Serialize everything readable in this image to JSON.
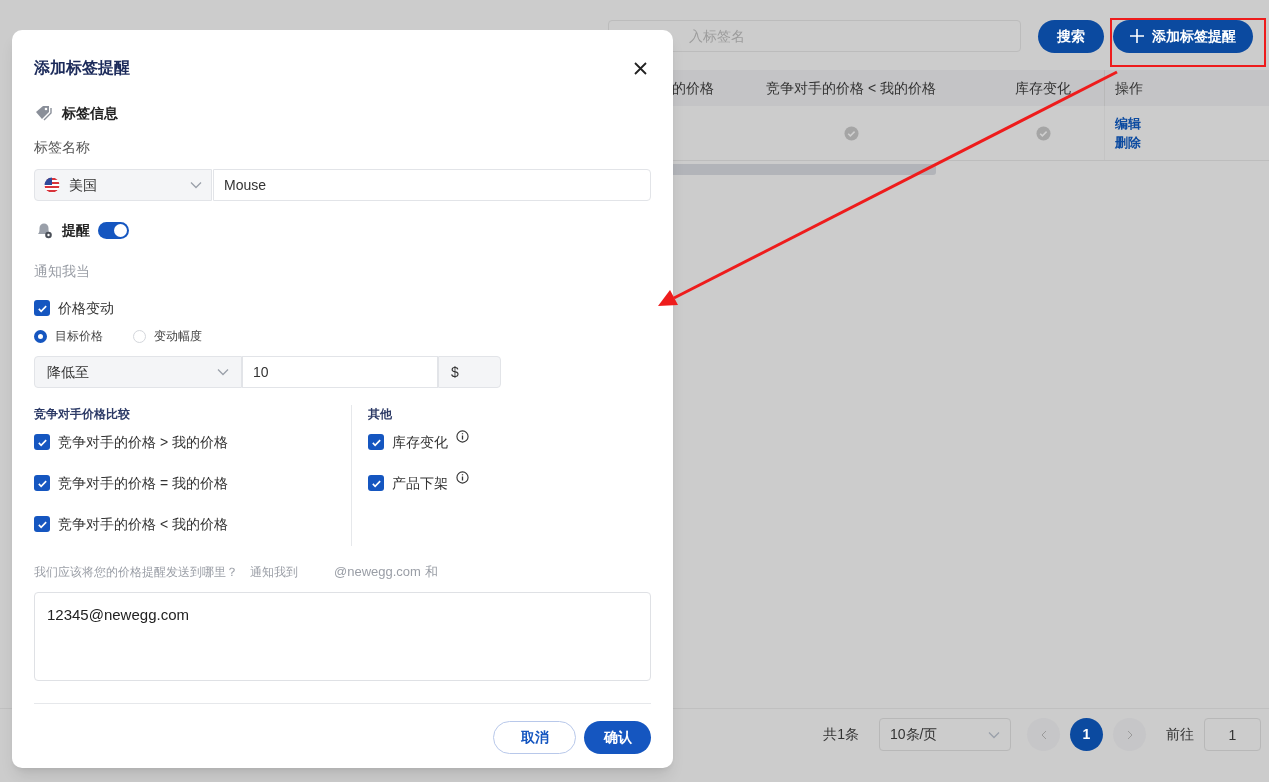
{
  "toolbar": {
    "search_placeholder": "入标签名",
    "buttons": [
      {
        "label": "搜索",
        "kind": "plain"
      },
      {
        "label": "添加标签提醒",
        "kind": "add"
      }
    ]
  },
  "table": {
    "columns": [
      "的价格",
      "竞争对手的价格 < 我的价格",
      "库存变化",
      "操作"
    ],
    "rows": [
      {
        "cells": [
          {
            "kind": "empty"
          },
          {
            "kind": "check"
          },
          {
            "kind": "check"
          },
          {
            "kind": "actions",
            "links": [
              "编辑",
              "删除"
            ]
          }
        ]
      }
    ]
  },
  "pagination": {
    "total": "共1条",
    "page_size": "10条/页",
    "pages": [
      {
        "label": "1",
        "selected": true
      }
    ],
    "goto_label": "前往",
    "goto_value": "1"
  },
  "dialog": {
    "title": "添加标签提醒",
    "tag_info": {
      "heading": "标签信息",
      "name_label": "标签名称",
      "country": "美国",
      "name_value": "Mouse"
    },
    "reminder": {
      "label": "提醒",
      "on": true
    },
    "notify_label": "通知我当",
    "price_change": {
      "label": "价格变动",
      "checked": true
    },
    "modes": [
      {
        "label": "目标价格",
        "selected": true
      },
      {
        "label": "变动幅度",
        "selected": false
      }
    ],
    "price_rule": {
      "direction": "降低至",
      "value": "10",
      "unit": "$"
    },
    "competitor": {
      "heading": "竞争对手价格比较",
      "options": [
        {
          "label": "竞争对手的价格 > 我的价格",
          "checked": true
        },
        {
          "label": "竞争对手的价格 = 我的价格",
          "checked": true
        },
        {
          "label": "竞争对手的价格 < 我的价格",
          "checked": true
        }
      ]
    },
    "other": {
      "heading": "其他",
      "options": [
        {
          "label": "库存变化",
          "checked": true,
          "info": true
        },
        {
          "label": "产品下架",
          "checked": true,
          "info": true
        }
      ]
    },
    "destination": {
      "question": "我们应该将您的价格提醒发送到哪里？",
      "notify_to": "通知我到",
      "domain": "@newegg.com 和",
      "emails": "12345@newegg.com"
    },
    "buttons": {
      "cancel": "取消",
      "confirm": "确认"
    }
  }
}
